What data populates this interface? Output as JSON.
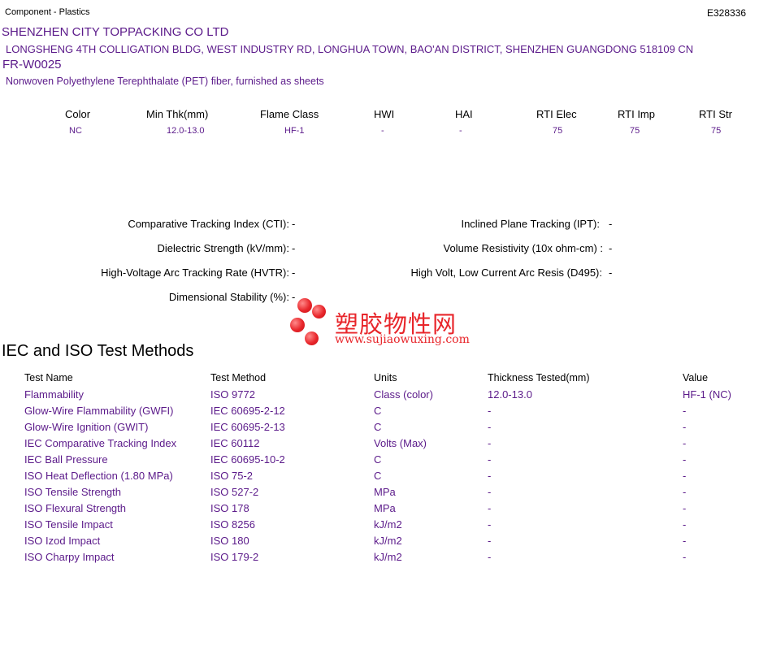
{
  "header": {
    "category": "Component - Plastics",
    "file_number": "E328336"
  },
  "company": {
    "name": "SHENZHEN CITY TOPPACKING CO LTD",
    "address": "LONGSHENG 4TH COLLIGATION BLDG, WEST INDUSTRY RD, LONGHUA TOWN, BAO'AN DISTRICT, SHENZHEN  GUANGDONG  518109 CN"
  },
  "product": {
    "id": "FR-W0025",
    "description": "Nonwoven Polyethylene Terephthalate (PET) fiber, furnished as sheets"
  },
  "properties": {
    "headers": [
      "Color",
      "Min Thk(mm)",
      "Flame Class",
      "HWI",
      "HAI",
      "RTI Elec",
      "RTI Imp",
      "RTI Str"
    ],
    "values": [
      "NC",
      "12.0-13.0",
      "HF-1",
      "-",
      "-",
      "75",
      "75",
      "75"
    ]
  },
  "electrical": {
    "left": [
      {
        "label": "Comparative Tracking Index (CTI):",
        "value": "-"
      },
      {
        "label": "Dielectric Strength (kV/mm):",
        "value": "-"
      },
      {
        "label": "High-Voltage Arc Tracking Rate (HVTR):",
        "value": "-"
      },
      {
        "label": "Dimensional Stability (%):",
        "value": "-"
      }
    ],
    "right": [
      {
        "label": "Inclined Plane Tracking (IPT):",
        "value": "-"
      },
      {
        "label": "Volume Resistivity (10x ohm-cm) :",
        "value": "-"
      },
      {
        "label": "High Volt, Low Current Arc Resis (D495):",
        "value": "-"
      }
    ]
  },
  "watermark": {
    "text_cn": "塑胶物性网",
    "url": "www.sujiaowuxing.com"
  },
  "iec_section": {
    "title": "IEC and ISO Test Methods",
    "headers": [
      "Test Name",
      "Test Method",
      "Units",
      "Thickness Tested(mm)",
      "Value"
    ],
    "rows": [
      [
        "Flammability",
        "ISO 9772",
        "Class (color)",
        "12.0-13.0",
        "HF-1 (NC)"
      ],
      [
        "Glow-Wire Flammability (GWFI)",
        "IEC 60695-2-12",
        "C",
        "-",
        "-"
      ],
      [
        "Glow-Wire Ignition (GWIT)",
        "IEC 60695-2-13",
        "C",
        "-",
        "-"
      ],
      [
        "IEC Comparative Tracking Index",
        "IEC 60112",
        "Volts (Max)",
        "-",
        "-"
      ],
      [
        "IEC Ball Pressure",
        "IEC 60695-10-2",
        "C",
        "-",
        "-"
      ],
      [
        "ISO Heat Deflection (1.80 MPa)",
        "ISO 75-2",
        "C",
        "-",
        "-"
      ],
      [
        "ISO Tensile Strength",
        "ISO 527-2",
        "MPa",
        "-",
        "-"
      ],
      [
        "ISO Flexural Strength",
        "ISO 178",
        "MPa",
        "-",
        "-"
      ],
      [
        "ISO Tensile Impact",
        "ISO 8256",
        "kJ/m2",
        "-",
        "-"
      ],
      [
        "ISO Izod Impact",
        "ISO 180",
        "kJ/m2",
        "-",
        "-"
      ],
      [
        "ISO Charpy Impact",
        "ISO 179-2",
        "kJ/m2",
        "-",
        "-"
      ]
    ]
  },
  "colors": {
    "accent_purple": "#5b1a8a",
    "watermark_red": "#e8262b"
  }
}
